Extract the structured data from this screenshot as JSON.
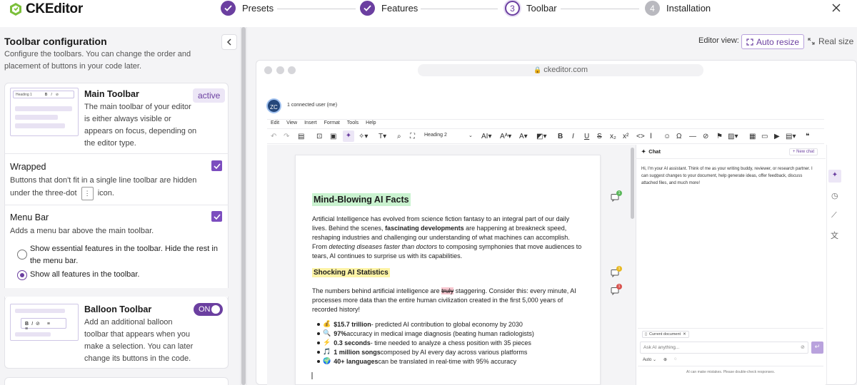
{
  "app": {
    "title": "CKEditor"
  },
  "steps": [
    {
      "label": "Presets",
      "state": "done"
    },
    {
      "label": "Features",
      "state": "done"
    },
    {
      "label": "Toolbar",
      "state": "current",
      "number": "3"
    },
    {
      "label": "Installation",
      "state": "pending",
      "number": "4"
    }
  ],
  "left_panel": {
    "title": "Toolbar configuration",
    "description": "Configure the toolbars. You can change the order and placement of buttons in your code later.",
    "main_toolbar": {
      "title": "Main Toolbar",
      "badge": "active",
      "description": "The main toolbar of your editor is either always visible or appears on focus, depending on the editor type.",
      "thumb_heading": "Heading 1"
    },
    "wrapped": {
      "title": "Wrapped",
      "description_before": "Buttons that don't fit in a single line toolbar are hidden under the three-dot",
      "description_after": "icon."
    },
    "menu_bar": {
      "title": "Menu Bar",
      "description": "Adds a menu bar above the main toolbar.",
      "options": [
        {
          "label": "Show essential features in the toolbar. Hide the rest in the menu bar.",
          "selected": false
        },
        {
          "label": "Show all features in the toolbar.",
          "selected": true
        }
      ]
    },
    "balloon_toolbar": {
      "title": "Balloon Toolbar",
      "toggle": "ON",
      "description": "Add an additional balloon toolbar that appears when you make a selection. You can later change its buttons in the code."
    }
  },
  "view_controls": {
    "label": "Editor view:",
    "auto_resize": "Auto resize",
    "real_size": "Real size"
  },
  "browser": {
    "url": "ckeditor.com"
  },
  "editor": {
    "avatar": "ZC",
    "connected": "1 connected user (me)",
    "menu": [
      "Edit",
      "View",
      "Insert",
      "Format",
      "Tools",
      "Help"
    ],
    "heading_select": "Heading 2",
    "doc": {
      "h1": "Mind-Blowing AI Facts",
      "p1": [
        {
          "t": "Artificial Intelligence has evolved from science fiction fantasy to an integral part of our daily lives. Behind the scenes, ",
          "s": "n"
        },
        {
          "t": "fascinating developments",
          "s": "b"
        },
        {
          "t": " are happening at breakneck speed, reshaping industries and challenging our understanding of what machines can accomplish. From ",
          "s": "n"
        },
        {
          "t": "detecting diseases faster than doctors",
          "s": "i"
        },
        {
          "t": " to composing symphonies that move audiences to tears, AI continues to surprise us with its capabilities.",
          "s": "n"
        }
      ],
      "h2": "Shocking AI Statistics",
      "p2_before": "The numbers behind artificial intelligence are ",
      "p2_strike": "truly",
      "p2_after": " staggering. Consider this: every minute, AI processes more data than the entire human civilization created in the first 5,000 years of recorded history!",
      "bullets": [
        {
          "emoji": "💰",
          "bold": "$15.7 trillion",
          "rest": " - predicted AI contribution to global economy by 2030"
        },
        {
          "emoji": "🔍",
          "bold": "97%",
          "rest": " accuracy in medical image diagnosis (beating human radiologists)"
        },
        {
          "emoji": "⚡",
          "bold": "0.3 seconds",
          "rest": " - time needed to analyze a chess position with 35 pieces"
        },
        {
          "emoji": "🎵",
          "bold": "1 million songs",
          "rest": " composed by AI every day across various platforms"
        },
        {
          "emoji": "🌍",
          "bold": "40+ languages",
          "rest": " can be translated in real-time with 95% accuracy"
        }
      ],
      "comment_counts": [
        "1",
        "1",
        "1"
      ]
    },
    "chat": {
      "title": "Chat",
      "new_chat": "+ New chat",
      "message": "Hi, I'm your AI assistant. Think of me as your writing buddy, reviewer, or research partner. I can suggest changes to your document, help generate ideas, offer feedback, discuss attached files, and much more!",
      "context_chip": "Current document",
      "input_placeholder": "Ask AI anything...",
      "model": "Auto",
      "disclaimer": "AI can make mistakes. Please double-check responses."
    }
  },
  "colors": {
    "accent": "#6b3fa0",
    "highlight_green": "#c9f2cf",
    "highlight_yellow": "#fdf3a6",
    "strike_mark": "#f7c6cf"
  }
}
